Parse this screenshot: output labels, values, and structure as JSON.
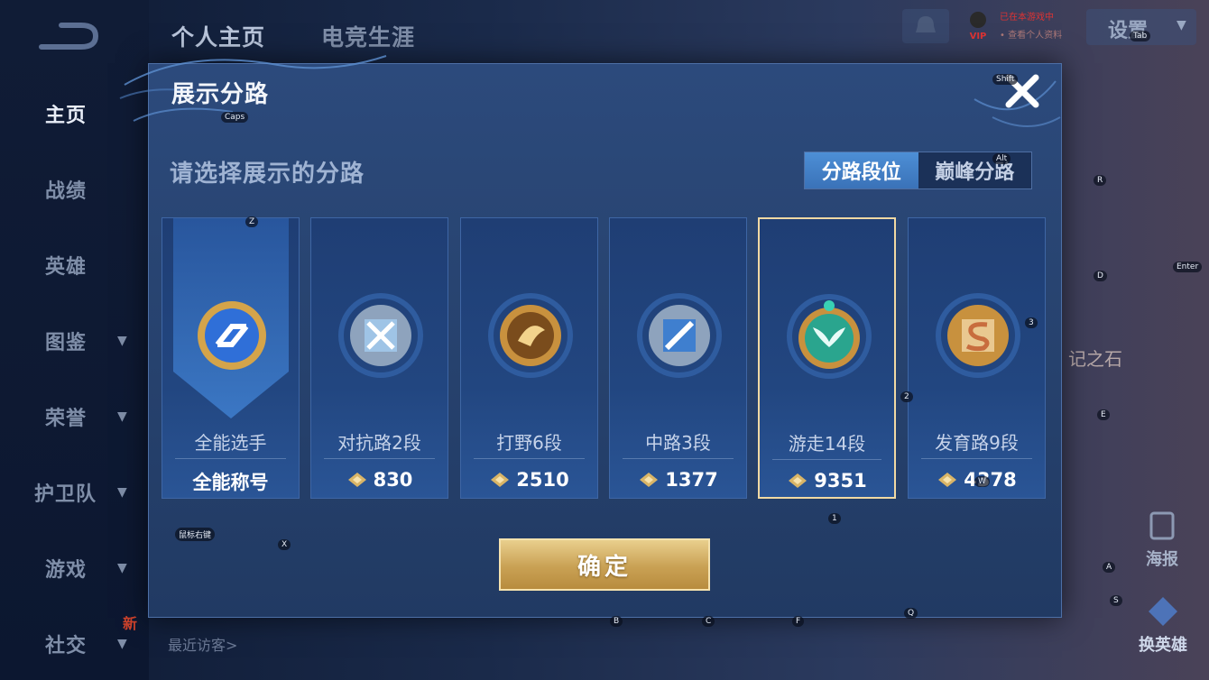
{
  "app": {
    "top_tabs": [
      {
        "label": "个人主页",
        "active": true
      },
      {
        "label": "电竞生涯",
        "active": false
      }
    ],
    "settings_label": "设置",
    "vip_label": "VIP",
    "vip_status": [
      "已在本游戏中",
      "• 查看个人资料"
    ],
    "sidebar": [
      {
        "label": "主页",
        "active": true,
        "chevron": false
      },
      {
        "label": "战绩",
        "active": false,
        "chevron": false
      },
      {
        "label": "英雄",
        "active": false,
        "chevron": false
      },
      {
        "label": "图鉴",
        "active": false,
        "chevron": true
      },
      {
        "label": "荣誉",
        "active": false,
        "chevron": true
      },
      {
        "label": "护卫队",
        "active": false,
        "chevron": true
      },
      {
        "label": "游戏",
        "active": false,
        "chevron": true
      },
      {
        "label": "社交",
        "active": false,
        "chevron": true
      }
    ],
    "new_badge": "新",
    "recent_visitors_label": "最近访客>",
    "right_deco_text": "记之石",
    "poster_label": "海报",
    "switch_hero_label": "换英雄"
  },
  "modal": {
    "title": "展示分路",
    "subtitle": "请选择展示的分路",
    "segment": [
      {
        "label": "分路段位",
        "active": true
      },
      {
        "label": "巅峰分路",
        "active": false
      }
    ],
    "cards": [
      {
        "role": "全能选手",
        "score": "全能称号",
        "show_points_icon": false,
        "selected": false,
        "emblem": "all-round-emblem-icon",
        "accent": "#2f6fd8"
      },
      {
        "role": "对抗路2段",
        "score": "830",
        "show_points_icon": true,
        "selected": false,
        "emblem": "clash-lane-emblem-icon",
        "accent": "#9fc4e6"
      },
      {
        "role": "打野6段",
        "score": "2510",
        "show_points_icon": true,
        "selected": false,
        "emblem": "jungle-emblem-icon",
        "accent": "#d3a24c"
      },
      {
        "role": "中路3段",
        "score": "1377",
        "show_points_icon": true,
        "selected": false,
        "emblem": "mid-lane-emblem-icon",
        "accent": "#9fc4e6"
      },
      {
        "role": "游走14段",
        "score": "9351",
        "show_points_icon": true,
        "selected": true,
        "emblem": "roam-emblem-icon",
        "accent": "#2aa58e"
      },
      {
        "role": "发育路9段",
        "score": "4378",
        "show_points_icon": true,
        "selected": false,
        "emblem": "farm-lane-emblem-icon",
        "accent": "#d3a24c"
      }
    ],
    "confirm_label": "确定"
  },
  "key_hints": [
    "Caps",
    "Shift",
    "Alt",
    "Z",
    "R",
    "Enter",
    "D",
    "3",
    "2",
    "E",
    "1",
    "W",
    "X",
    "鼠标右键",
    "A",
    "S",
    "Q",
    "B",
    "C",
    "F",
    "Tab"
  ]
}
